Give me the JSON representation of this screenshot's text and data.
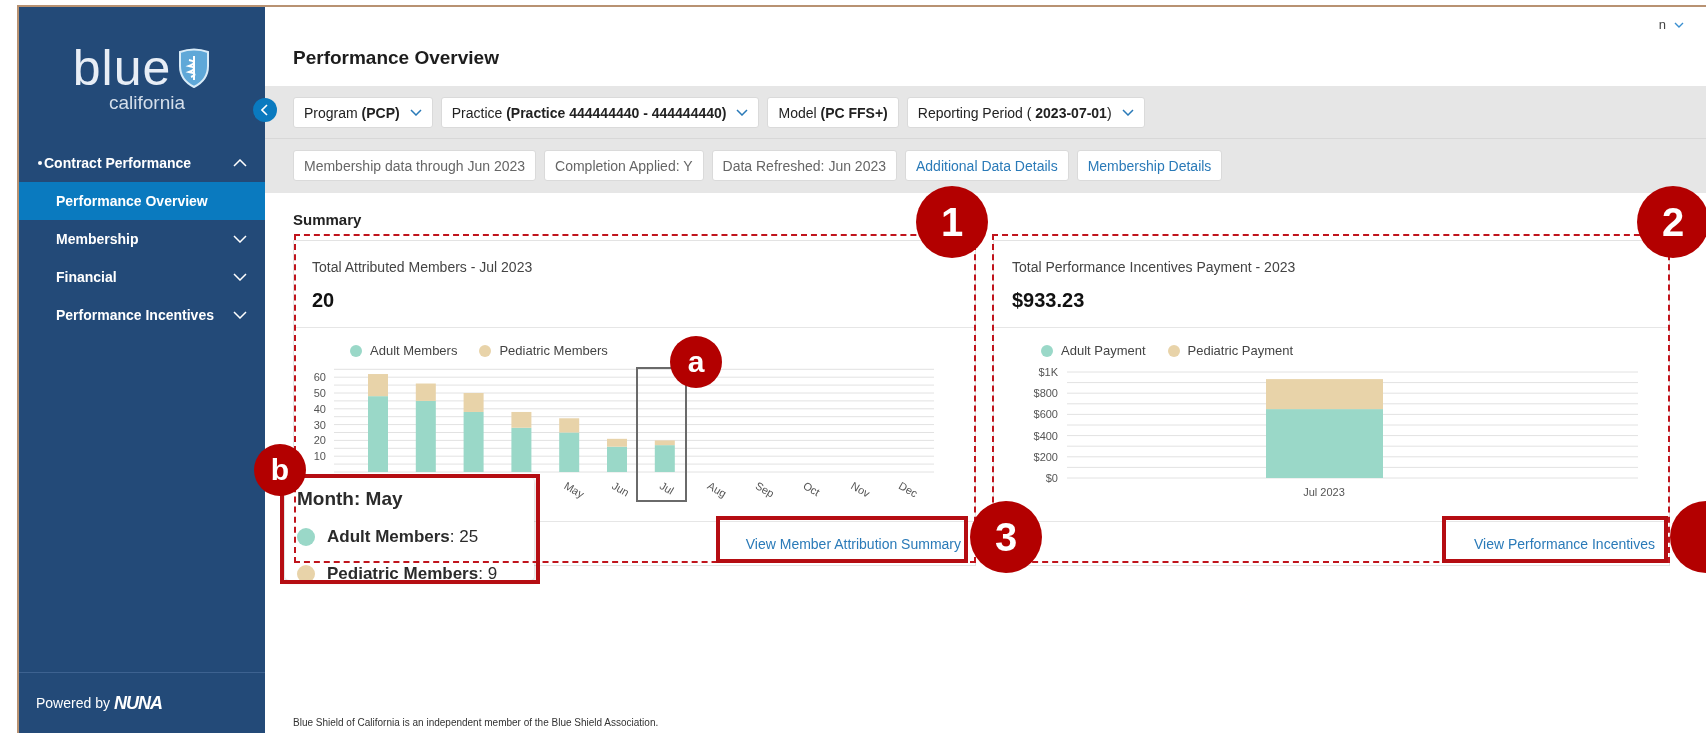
{
  "user_menu": {
    "label": "n"
  },
  "sidebar": {
    "logo": {
      "word": "blue",
      "sub": "california"
    },
    "items": [
      {
        "label": "Contract Performance",
        "active": true,
        "expanded": true,
        "children": [
          {
            "label": "Performance Overview",
            "selected": true
          }
        ]
      },
      {
        "label": "Membership",
        "active": false,
        "expanded": false
      },
      {
        "label": "Financial",
        "active": false,
        "expanded": false
      },
      {
        "label": "Performance Incentives",
        "active": false,
        "expanded": false
      }
    ],
    "footer": {
      "text": "Powered by",
      "brand": "NUNA"
    }
  },
  "page_title": "Performance Overview",
  "filters": [
    {
      "text": "Program **(PCP)**",
      "kind": "dropdown"
    },
    {
      "text": "Practice **(Practice 444444440 - 444444440)**",
      "kind": "dropdown"
    },
    {
      "text": "Model **(PC FFS+)**",
      "kind": "static"
    },
    {
      "text": "Reporting Period ( **2023-07-01**)",
      "kind": "dropdown"
    }
  ],
  "info_chips": [
    {
      "text": "Membership data through Jun 2023",
      "kind": "info"
    },
    {
      "text": "Completion Applied: Y",
      "kind": "info"
    },
    {
      "text": "Data Refreshed: Jun 2023",
      "kind": "info"
    },
    {
      "text": "Additional Data Details",
      "kind": "link"
    },
    {
      "text": "Membership Details",
      "kind": "link"
    }
  ],
  "section_title": "Summary",
  "cards": [
    {
      "title": "Total Attributed Members - Jul 2023",
      "value": "20",
      "link": "View Member Attribution Summary",
      "chart_data": {
        "type": "bar",
        "stacked": true,
        "categories": [
          null,
          null,
          null,
          null,
          "May",
          "Jun",
          "Jul",
          "Aug",
          "Sep",
          "Oct",
          "Nov",
          "Dec"
        ],
        "ylim": [
          0,
          65
        ],
        "grid": true,
        "yticks": [
          10,
          20,
          30,
          40,
          50,
          60
        ],
        "series": [
          {
            "name": "Adult Members",
            "color": "#9ad8c8",
            "values": [
              48,
              45,
              38,
              28,
              25,
              16,
              17,
              null,
              null,
              null,
              null,
              null
            ]
          },
          {
            "name": "Pediatric Members",
            "color": "#e8d3a9",
            "values": [
              14,
              11,
              12,
              10,
              9,
              5,
              3,
              null,
              null,
              null,
              null,
              null
            ]
          }
        ]
      }
    },
    {
      "title": "Total Performance Incentives Payment - 2023",
      "value": "$933.23",
      "link": "View Performance Incentives",
      "chart_data": {
        "type": "bar",
        "stacked": true,
        "categories": [
          "Jul 2023"
        ],
        "ylim": [
          0,
          1000
        ],
        "grid": true,
        "yticks": [
          {
            "value": 0,
            "label": "$0"
          },
          {
            "value": 200,
            "label": "$200"
          },
          {
            "value": 400,
            "label": "$400"
          },
          {
            "value": 600,
            "label": "$600"
          },
          {
            "value": 800,
            "label": "$800"
          },
          {
            "value": 1000,
            "label": "$1K"
          }
        ],
        "series": [
          {
            "name": "Adult Payment",
            "color": "#9ad8c8",
            "values": [
              650
            ]
          },
          {
            "name": "Pediatric Payment",
            "color": "#e8d3a9",
            "values": [
              283
            ]
          }
        ]
      }
    }
  ],
  "tooltip": {
    "title": "Month: May",
    "rows": [
      {
        "text": "**Adult Members**: 25",
        "color": "#9ad8c8"
      },
      {
        "text": "**Pediatric Members**: 9",
        "color": "#e8d3a9"
      }
    ]
  },
  "footnote": "Blue Shield of California is an independent member of the Blue Shield Association.",
  "annotations": [
    {
      "label": "1"
    },
    {
      "label": "2"
    },
    {
      "label": "3"
    },
    {
      "label": "a"
    },
    {
      "label": "b"
    }
  ]
}
